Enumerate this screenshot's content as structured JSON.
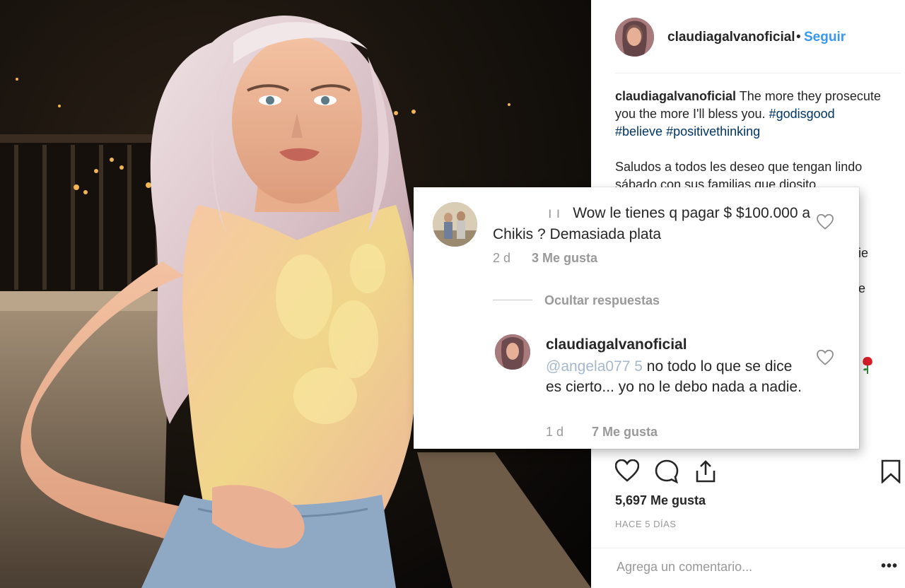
{
  "post": {
    "username": "claudiagalvanoficial",
    "separator": "•",
    "follow_label": "Seguir",
    "caption_text": "The more they prosecute you the more I'll bless you.",
    "hashtags": [
      "#godisgood",
      "#believe",
      "#positivethinking"
    ],
    "caption_para2": "Saludos a todos les deseo que tengan lindo sábado con sus familias que diosito",
    "peek_fragments": [
      "ie",
      "e"
    ],
    "likes_count": "5,697 Me gusta",
    "time_ago": "HACE 5 DÍAS",
    "comment_placeholder": "Agrega un comentario...",
    "more_options": "•••"
  },
  "comment_card": {
    "comment": {
      "user_fragment": "ı ı",
      "text": "Wow le tienes q pagar $ $100.000 a Chikis ? Demasiada plata",
      "age": "2 d",
      "likes": "3 Me gusta"
    },
    "hide_replies_label": "Ocultar respuestas",
    "reply": {
      "username": "claudiagalvanoficial",
      "mention": "@angela077 5",
      "text": "no todo lo que se dice es cierto... yo no le debo nada a nadie.",
      "age": "1 d",
      "likes": "7 Me gusta"
    }
  },
  "icons": {
    "like": "heart-icon",
    "comment": "comment-bubble-icon",
    "share": "share-icon",
    "save": "bookmark-icon",
    "rose": "rose-emoji-icon"
  },
  "colors": {
    "link_blue": "#3897f0",
    "hashtag_blue": "#003569",
    "muted_gray": "#999999"
  }
}
